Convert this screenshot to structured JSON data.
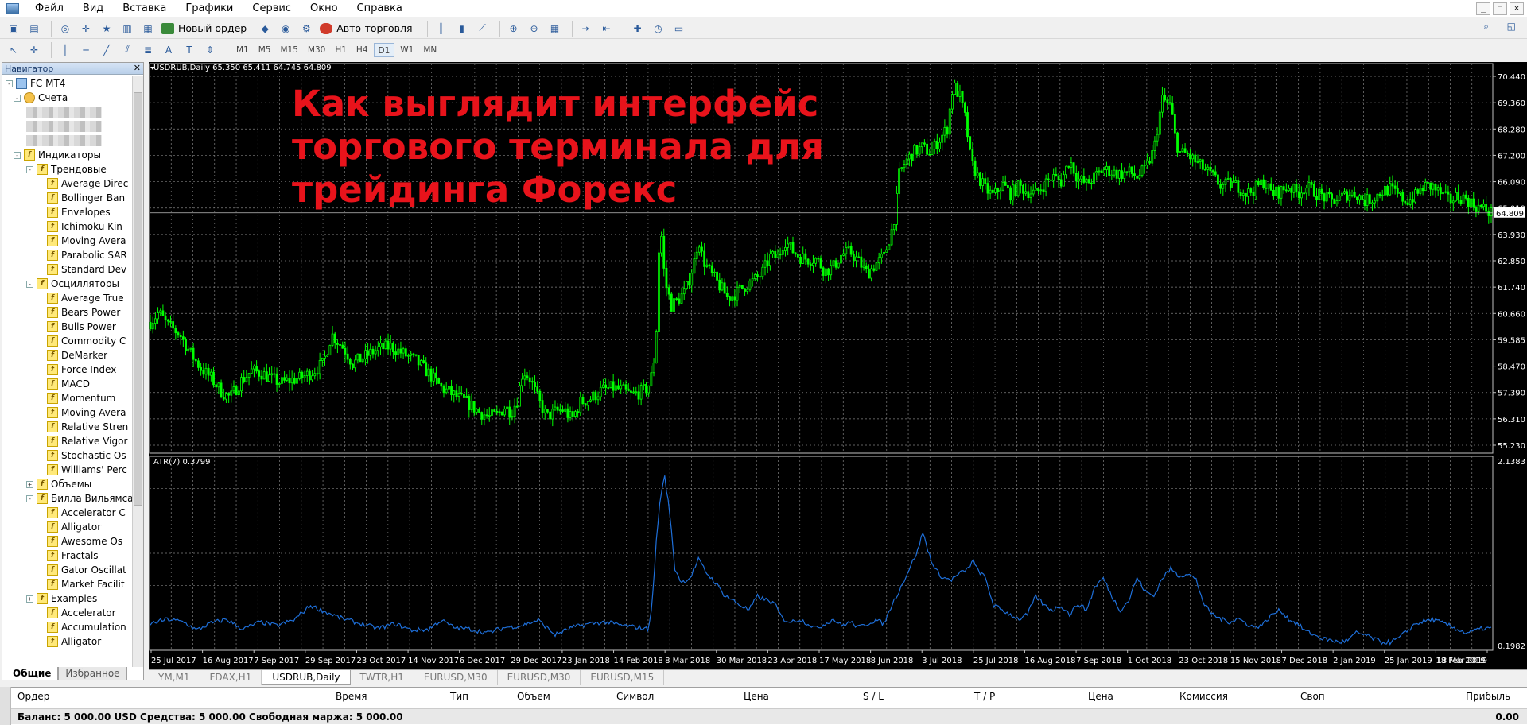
{
  "menu": [
    "Файл",
    "Вид",
    "Вставка",
    "Графики",
    "Сервис",
    "Окно",
    "Справка"
  ],
  "toolbar": {
    "new_order": "Новый ордер",
    "auto_trading": "Авто-торговля"
  },
  "timeframes": [
    "M1",
    "M5",
    "M15",
    "M30",
    "H1",
    "H4",
    "D1",
    "W1",
    "MN"
  ],
  "active_timeframe": "D1",
  "navigator": {
    "title": "Навигатор",
    "root": "FC MT4",
    "accounts": "Счета",
    "indicators": "Индикаторы",
    "trend": "Трендовые",
    "trend_items": [
      "Average Direc",
      "Bollinger Ban",
      "Envelopes",
      "Ichimoku Kin",
      "Moving Avera",
      "Parabolic SAR",
      "Standard Dev"
    ],
    "oscillators": "Осцилляторы",
    "osc_items": [
      "Average True",
      "Bears Power",
      "Bulls Power",
      "Commodity C",
      "DeMarker",
      "Force Index",
      "MACD",
      "Momentum",
      "Moving Avera",
      "Relative Stren",
      "Relative Vigor",
      "Stochastic Os",
      "Williams' Perc"
    ],
    "volumes": "Объемы",
    "bill_williams": "Билла Вильямса",
    "bw_items": [
      "Accelerator C",
      "Alligator",
      "Awesome Os",
      "Fractals",
      "Gator Oscillat",
      "Market Facilit"
    ],
    "examples": "Examples",
    "bottom_items": [
      "Accelerator",
      "Accumulation",
      "Alligator"
    ],
    "tabs": [
      "Общие",
      "Избранное"
    ]
  },
  "chart": {
    "header": "USDRUB,Daily  65.350 65.411 64.745 64.809",
    "overlay_lines": [
      "Как выглядит интерфейс",
      "торгового терминала для",
      "трейдинга Форекс"
    ],
    "sub_header": "ATR(7) 0.3799",
    "current_price": "64.809",
    "main_ticks": [
      "70.440",
      "69.360",
      "68.280",
      "67.200",
      "66.090",
      "65.010",
      "63.930",
      "62.850",
      "61.740",
      "60.660",
      "59.585",
      "58.470",
      "57.390",
      "56.310",
      "55.230"
    ],
    "sub_ticks": [
      "2.1383",
      "0.1982"
    ],
    "date_labels": [
      "25 Jul 2017",
      "16 Aug 2017",
      "7 Sep 2017",
      "29 Sep 2017",
      "23 Oct 2017",
      "14 Nov 2017",
      "6 Dec 2017",
      "29 Dec 2017",
      "23 Jan 2018",
      "14 Feb 2018",
      "8 Mar 2018",
      "30 Mar 2018",
      "23 Apr 2018",
      "17 May 2018",
      "8 Jun 2018",
      "3 Jul 2018",
      "25 Jul 2018",
      "16 Aug 2018",
      "7 Sep 2018",
      "1 Oct 2018",
      "23 Oct 2018",
      "15 Nov 2018",
      "7 Dec 2018",
      "2 Jan 2019",
      "25 Jan 2019",
      "18 Feb 2019",
      "13 Mar 2019"
    ],
    "price_path": [
      [
        0,
        60.3
      ],
      [
        10,
        60.7
      ],
      [
        20,
        60.2
      ],
      [
        35,
        59.8
      ],
      [
        48,
        59.0
      ],
      [
        60,
        58.4
      ],
      [
        72,
        58.0
      ],
      [
        85,
        57.4
      ],
      [
        95,
        57.2
      ],
      [
        108,
        57.9
      ],
      [
        120,
        58.3
      ],
      [
        132,
        58.2
      ],
      [
        142,
        58.0
      ],
      [
        155,
        57.8
      ],
      [
        165,
        57.9
      ],
      [
        178,
        58.0
      ],
      [
        190,
        58.2
      ],
      [
        205,
        58.6
      ],
      [
        215,
        59.8
      ],
      [
        230,
        59.2
      ],
      [
        240,
        58.6
      ],
      [
        255,
        58.9
      ],
      [
        270,
        59.2
      ],
      [
        285,
        59.3
      ],
      [
        300,
        59.0
      ],
      [
        315,
        58.7
      ],
      [
        330,
        58.2
      ],
      [
        345,
        57.6
      ],
      [
        360,
        57.3
      ],
      [
        375,
        57.0
      ],
      [
        390,
        56.6
      ],
      [
        402,
        56.4
      ],
      [
        412,
        56.5
      ],
      [
        420,
        56.8
      ],
      [
        428,
        56.6
      ],
      [
        435,
        57.1
      ],
      [
        442,
        58.3
      ],
      [
        450,
        58.0
      ],
      [
        460,
        57.1
      ],
      [
        470,
        56.4
      ],
      [
        480,
        56.6
      ],
      [
        490,
        56.7
      ],
      [
        500,
        56.3
      ],
      [
        510,
        57.0
      ],
      [
        520,
        57.1
      ],
      [
        535,
        57.5
      ],
      [
        548,
        57.6
      ],
      [
        560,
        57.5
      ],
      [
        570,
        57.3
      ],
      [
        580,
        57.4
      ],
      [
        590,
        57.6
      ],
      [
        596,
        58.3
      ],
      [
        600,
        60.0
      ],
      [
        602,
        62.7
      ],
      [
        605,
        64.3
      ],
      [
        610,
        62.0
      ],
      [
        618,
        61.0
      ],
      [
        625,
        61.2
      ],
      [
        635,
        61.6
      ],
      [
        645,
        62.8
      ],
      [
        650,
        63.8
      ],
      [
        655,
        62.9
      ],
      [
        665,
        62.3
      ],
      [
        675,
        61.8
      ],
      [
        685,
        61.3
      ],
      [
        695,
        61.5
      ],
      [
        705,
        61.8
      ],
      [
        715,
        62.0
      ],
      [
        725,
        62.3
      ],
      [
        735,
        63.0
      ],
      [
        745,
        63.0
      ],
      [
        752,
        63.7
      ],
      [
        760,
        63.3
      ],
      [
        770,
        63.0
      ],
      [
        780,
        62.9
      ],
      [
        790,
        62.9
      ],
      [
        800,
        62.4
      ],
      [
        810,
        62.6
      ],
      [
        820,
        63.1
      ],
      [
        830,
        63.2
      ],
      [
        840,
        62.8
      ],
      [
        850,
        62.3
      ],
      [
        860,
        62.7
      ],
      [
        870,
        63.0
      ],
      [
        875,
        63.6
      ],
      [
        880,
        64.2
      ],
      [
        884,
        65.0
      ],
      [
        888,
        66.4
      ],
      [
        895,
        66.9
      ],
      [
        905,
        67.3
      ],
      [
        915,
        67.5
      ],
      [
        925,
        67.3
      ],
      [
        935,
        67.8
      ],
      [
        945,
        68.3
      ],
      [
        952,
        70.1
      ],
      [
        960,
        69.6
      ],
      [
        967,
        68.6
      ],
      [
        973,
        66.9
      ],
      [
        980,
        66.4
      ],
      [
        990,
        65.8
      ],
      [
        1000,
        65.5
      ],
      [
        1010,
        66.0
      ],
      [
        1020,
        65.6
      ],
      [
        1030,
        65.9
      ],
      [
        1040,
        65.7
      ],
      [
        1050,
        65.6
      ],
      [
        1060,
        66.0
      ],
      [
        1070,
        66.3
      ],
      [
        1080,
        66.1
      ],
      [
        1090,
        67.0
      ],
      [
        1100,
        66.2
      ],
      [
        1110,
        66.0
      ],
      [
        1120,
        66.3
      ],
      [
        1130,
        66.6
      ],
      [
        1140,
        66.5
      ],
      [
        1150,
        66.4
      ],
      [
        1160,
        66.5
      ],
      [
        1170,
        66.3
      ],
      [
        1180,
        66.6
      ],
      [
        1190,
        67.4
      ],
      [
        1195,
        68.5
      ],
      [
        1200,
        69.5
      ],
      [
        1210,
        69.2
      ],
      [
        1215,
        68.0
      ],
      [
        1220,
        67.3
      ],
      [
        1230,
        67.2
      ],
      [
        1240,
        66.9
      ],
      [
        1250,
        66.6
      ],
      [
        1260,
        66.3
      ],
      [
        1270,
        65.9
      ],
      [
        1280,
        66.0
      ],
      [
        1290,
        65.9
      ],
      [
        1300,
        65.6
      ],
      [
        1310,
        65.8
      ],
      [
        1320,
        66.1
      ],
      [
        1330,
        65.6
      ],
      [
        1340,
        65.7
      ],
      [
        1350,
        65.9
      ],
      [
        1360,
        65.6
      ],
      [
        1370,
        65.9
      ],
      [
        1380,
        65.7
      ],
      [
        1390,
        65.5
      ],
      [
        1400,
        65.3
      ],
      [
        1410,
        65.4
      ],
      [
        1420,
        65.6
      ],
      [
        1430,
        65.6
      ],
      [
        1440,
        65.3
      ],
      [
        1450,
        65.4
      ],
      [
        1460,
        65.7
      ],
      [
        1470,
        65.8
      ],
      [
        1480,
        65.5
      ],
      [
        1490,
        65.3
      ],
      [
        1500,
        65.5
      ],
      [
        1510,
        65.9
      ],
      [
        1520,
        65.9
      ],
      [
        1530,
        65.6
      ],
      [
        1540,
        65.3
      ],
      [
        1550,
        65.5
      ],
      [
        1560,
        65.4
      ],
      [
        1570,
        65.1
      ],
      [
        1580,
        65.0
      ],
      [
        1590,
        64.8
      ]
    ],
    "atr_path": [
      [
        0,
        0.4
      ],
      [
        20,
        0.45
      ],
      [
        40,
        0.42
      ],
      [
        55,
        0.33
      ],
      [
        70,
        0.4
      ],
      [
        90,
        0.45
      ],
      [
        110,
        0.34
      ],
      [
        130,
        0.42
      ],
      [
        150,
        0.38
      ],
      [
        170,
        0.44
      ],
      [
        190,
        0.6
      ],
      [
        210,
        0.52
      ],
      [
        230,
        0.45
      ],
      [
        250,
        0.4
      ],
      [
        270,
        0.35
      ],
      [
        290,
        0.4
      ],
      [
        310,
        0.33
      ],
      [
        330,
        0.34
      ],
      [
        345,
        0.44
      ],
      [
        360,
        0.36
      ],
      [
        380,
        0.34
      ],
      [
        400,
        0.3
      ],
      [
        420,
        0.36
      ],
      [
        440,
        0.38
      ],
      [
        460,
        0.44
      ],
      [
        480,
        0.28
      ],
      [
        500,
        0.36
      ],
      [
        520,
        0.4
      ],
      [
        540,
        0.42
      ],
      [
        560,
        0.38
      ],
      [
        580,
        0.36
      ],
      [
        590,
        0.34
      ],
      [
        595,
        0.6
      ],
      [
        600,
        1.3
      ],
      [
        605,
        1.8
      ],
      [
        610,
        2.0
      ],
      [
        616,
        1.6
      ],
      [
        622,
        1.0
      ],
      [
        630,
        0.85
      ],
      [
        640,
        0.9
      ],
      [
        650,
        1.1
      ],
      [
        660,
        0.95
      ],
      [
        670,
        0.85
      ],
      [
        680,
        0.72
      ],
      [
        690,
        0.66
      ],
      [
        700,
        0.6
      ],
      [
        710,
        0.55
      ],
      [
        720,
        0.7
      ],
      [
        730,
        0.66
      ],
      [
        740,
        0.62
      ],
      [
        750,
        0.45
      ],
      [
        760,
        0.42
      ],
      [
        770,
        0.45
      ],
      [
        780,
        0.4
      ],
      [
        790,
        0.35
      ],
      [
        800,
        0.4
      ],
      [
        810,
        0.45
      ],
      [
        820,
        0.38
      ],
      [
        830,
        0.42
      ],
      [
        840,
        0.36
      ],
      [
        850,
        0.4
      ],
      [
        860,
        0.44
      ],
      [
        870,
        0.4
      ],
      [
        880,
        0.62
      ],
      [
        890,
        0.8
      ],
      [
        900,
        1.0
      ],
      [
        910,
        1.2
      ],
      [
        916,
        1.4
      ],
      [
        922,
        1.2
      ],
      [
        930,
        1.0
      ],
      [
        940,
        0.9
      ],
      [
        950,
        0.88
      ],
      [
        960,
        0.95
      ],
      [
        970,
        1.0
      ],
      [
        975,
        1.1
      ],
      [
        980,
        1.0
      ],
      [
        990,
        0.9
      ],
      [
        1000,
        0.6
      ],
      [
        1010,
        0.55
      ],
      [
        1020,
        0.5
      ],
      [
        1030,
        0.45
      ],
      [
        1040,
        0.5
      ],
      [
        1050,
        0.7
      ],
      [
        1060,
        0.6
      ],
      [
        1070,
        0.55
      ],
      [
        1080,
        0.6
      ],
      [
        1090,
        0.5
      ],
      [
        1100,
        0.62
      ],
      [
        1110,
        0.55
      ],
      [
        1120,
        0.8
      ],
      [
        1130,
        0.9
      ],
      [
        1140,
        0.7
      ],
      [
        1150,
        0.55
      ],
      [
        1160,
        0.65
      ],
      [
        1170,
        0.9
      ],
      [
        1180,
        0.75
      ],
      [
        1190,
        0.7
      ],
      [
        1200,
        0.9
      ],
      [
        1210,
        1.0
      ],
      [
        1220,
        0.92
      ],
      [
        1230,
        0.95
      ],
      [
        1240,
        0.88
      ],
      [
        1250,
        0.6
      ],
      [
        1260,
        0.5
      ],
      [
        1270,
        0.45
      ],
      [
        1280,
        0.42
      ],
      [
        1290,
        0.46
      ],
      [
        1300,
        0.4
      ],
      [
        1310,
        0.36
      ],
      [
        1320,
        0.4
      ],
      [
        1330,
        0.5
      ],
      [
        1340,
        0.55
      ],
      [
        1350,
        0.45
      ],
      [
        1360,
        0.4
      ],
      [
        1370,
        0.32
      ],
      [
        1380,
        0.28
      ],
      [
        1390,
        0.24
      ],
      [
        1400,
        0.22
      ],
      [
        1410,
        0.2
      ],
      [
        1420,
        0.22
      ],
      [
        1430,
        0.3
      ],
      [
        1440,
        0.28
      ],
      [
        1450,
        0.24
      ],
      [
        1460,
        0.2
      ],
      [
        1470,
        0.2
      ],
      [
        1480,
        0.24
      ],
      [
        1500,
        0.4
      ],
      [
        1520,
        0.45
      ],
      [
        1540,
        0.38
      ],
      [
        1560,
        0.3
      ],
      [
        1580,
        0.35
      ]
    ]
  },
  "chart_tabs": [
    "YM,M1",
    "FDAX,H1",
    "USDRUB,Daily",
    "TWTR,H1",
    "EURUSD,M30",
    "EURUSD,M30",
    "EURUSD,M15"
  ],
  "active_chart_tab": "USDRUB,Daily",
  "orders": {
    "columns": [
      "Ордер",
      "Время",
      "Тип",
      "Объем",
      "Символ",
      "Цена",
      "S / L",
      "T / P",
      "Цена",
      "Комиссия",
      "Своп",
      "Прибыль"
    ],
    "balance": "Баланс: 5 000.00 USD  Средства: 5 000.00  Свободная маржа: 5 000.00",
    "profit": "0.00"
  },
  "colors": {
    "bull": "#00ff00",
    "atr": "#1e6fd9",
    "overlay": "#e8131b",
    "grid": "#808080"
  }
}
